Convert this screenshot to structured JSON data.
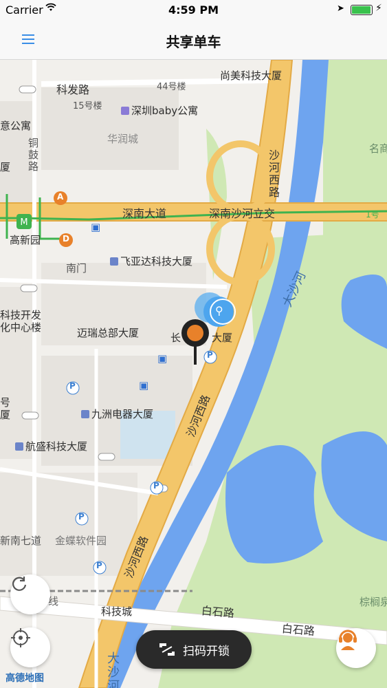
{
  "status_bar": {
    "carrier": "Carrier",
    "time": "4:59 PM"
  },
  "nav": {
    "title": "共享单车"
  },
  "map": {
    "roads": {
      "kefa": "科发路",
      "shennan_dadao": "深南大道",
      "shennan_shahe": "深南沙河立交",
      "shahe_xilu_top": "沙河西路",
      "shahe_xilu_mid": "沙河西路",
      "shahe_xilu_bottom": "沙河西路",
      "baishi_1": "白石路",
      "baishi_2": "白石路",
      "tongguludao": "铜鼓路",
      "shennan_qidao": "新南七道"
    },
    "water": {
      "dashahe_1": "大沙河",
      "dashahe_2": "大沙河"
    },
    "places": {
      "shangmei": "尚美科技大厦",
      "b44": "44号楼",
      "b15": "15号楼",
      "baby": "深圳baby公寓",
      "huarun": "华润城",
      "yi_gongyu": "意公寓",
      "xia_left": "厦",
      "gaoxinyuan": "高新园",
      "nanmen": "南门",
      "feiyada": "飞亚达科技大厦",
      "keji_kaifa": "科技开发",
      "hua_zhongxin": "化中心楼",
      "mairui": "迈瑞总部大厦",
      "chang": "长",
      "da_xia": "大厦",
      "jiuzhou": "九洲电器大厦",
      "hao": "号",
      "xia_left2": "厦",
      "hangsheng": "航盛科技大厦",
      "jindie": "金蝶软件园",
      "kejicheng": "科技城",
      "zonglv": "棕榈泉",
      "mingge": "名商",
      "xian": "线",
      "metro_a": "A",
      "metro_d": "D",
      "right_edge": "1号"
    },
    "marker": {
      "bike_label": "bike"
    }
  },
  "buttons": {
    "scan_unlock": "扫码开锁"
  },
  "attribution": "高德地图",
  "colors": {
    "accent": "#3a8ee6",
    "road_major": "#f3c66a",
    "water": "#6ea4ef",
    "park": "#cfe8b4",
    "marker_orange": "#e8812a",
    "metro_green": "#3fb34f"
  }
}
